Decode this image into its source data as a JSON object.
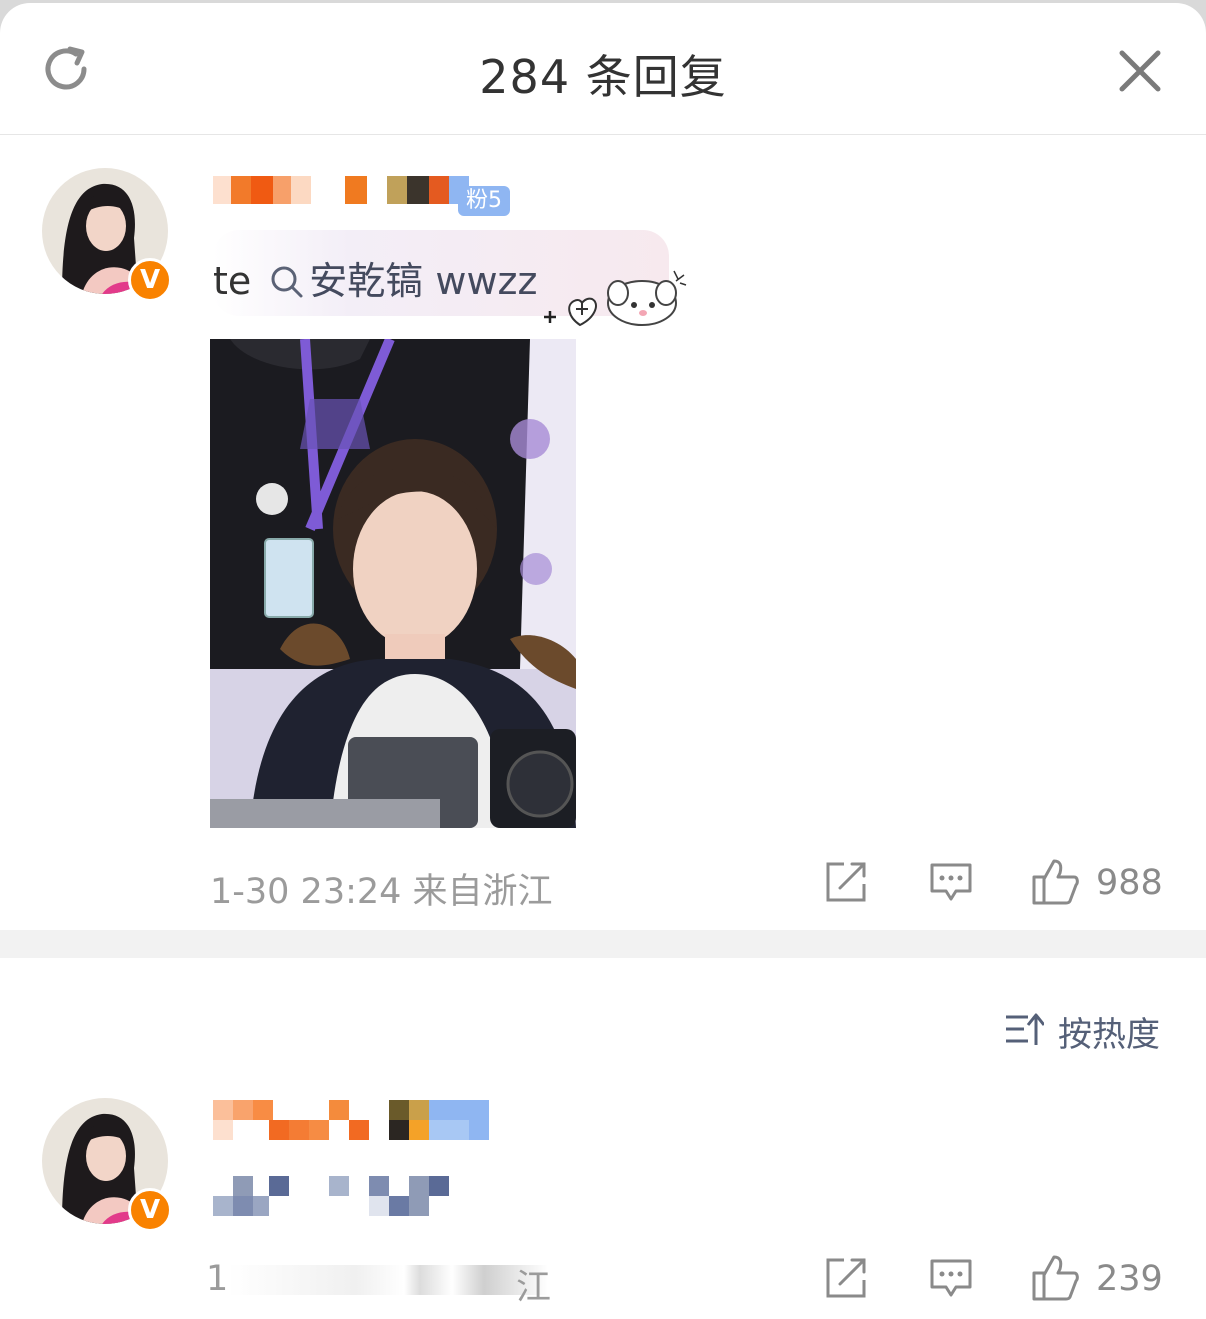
{
  "header": {
    "title": "284 条回复"
  },
  "comment_main": {
    "author": "",
    "fan_card": {
      "prefix": "te",
      "search_text": "安乾镐 wwzz",
      "badge_text": "粉5"
    },
    "meta": "1-30 23:24 来自浙江",
    "likes": "988"
  },
  "sort": {
    "label": "按热度"
  },
  "reply_1": {
    "meta_visible": "1-",
    "meta_suffix": "江",
    "likes": "239"
  },
  "colors": {
    "vip_badge": "#f98200",
    "divider": "#f2f2f2",
    "sort_text": "#556078"
  }
}
